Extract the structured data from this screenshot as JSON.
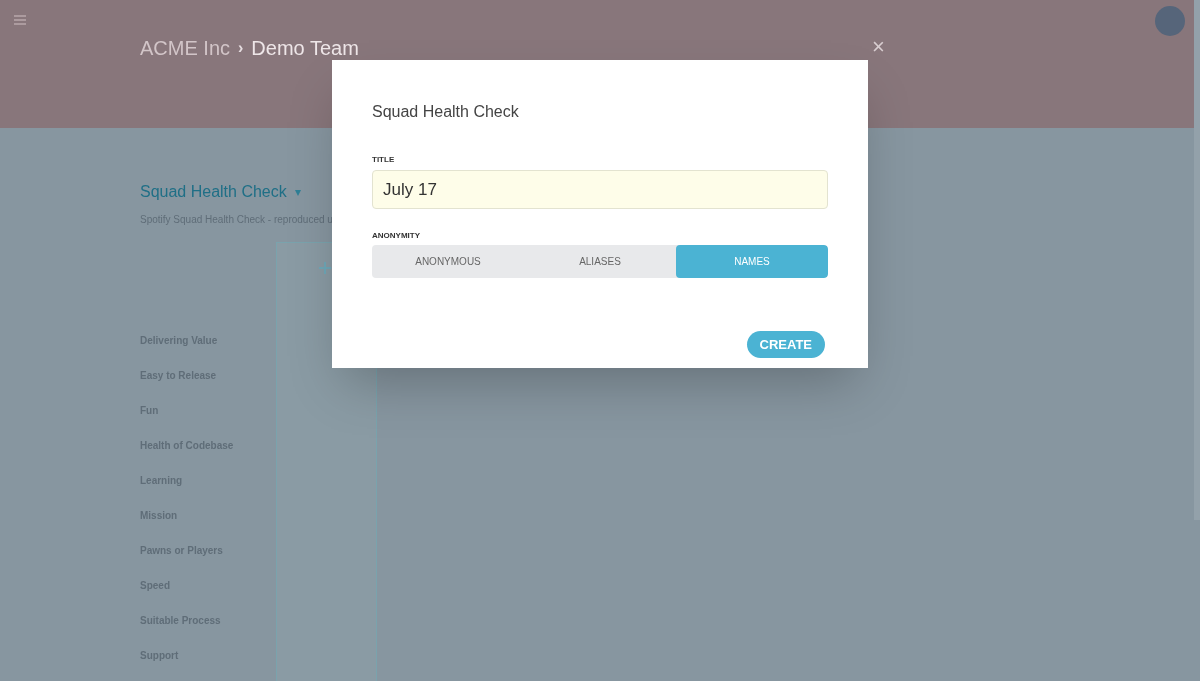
{
  "header": {
    "org": "ACME Inc",
    "separator": "›",
    "team": "Demo Team"
  },
  "page": {
    "title": "Squad Health Check",
    "caret": "▾",
    "subtitle": "Spotify Squad Health Check - reproduced u"
  },
  "rows": [
    "Delivering Value",
    "Easy to Release",
    "Fun",
    "Health of Codebase",
    "Learning",
    "Mission",
    "Pawns or Players",
    "Speed",
    "Suitable Process",
    "Support"
  ],
  "dialog": {
    "title": "Squad Health Check",
    "title_label": "TITLE",
    "title_value": "July 17",
    "anonymity_label": "ANONYMITY",
    "options": [
      {
        "label": "ANONYMOUS",
        "selected": false
      },
      {
        "label": "ALIASES",
        "selected": false
      },
      {
        "label": "NAMES",
        "selected": true
      }
    ],
    "create": "CREATE",
    "close": "×"
  }
}
